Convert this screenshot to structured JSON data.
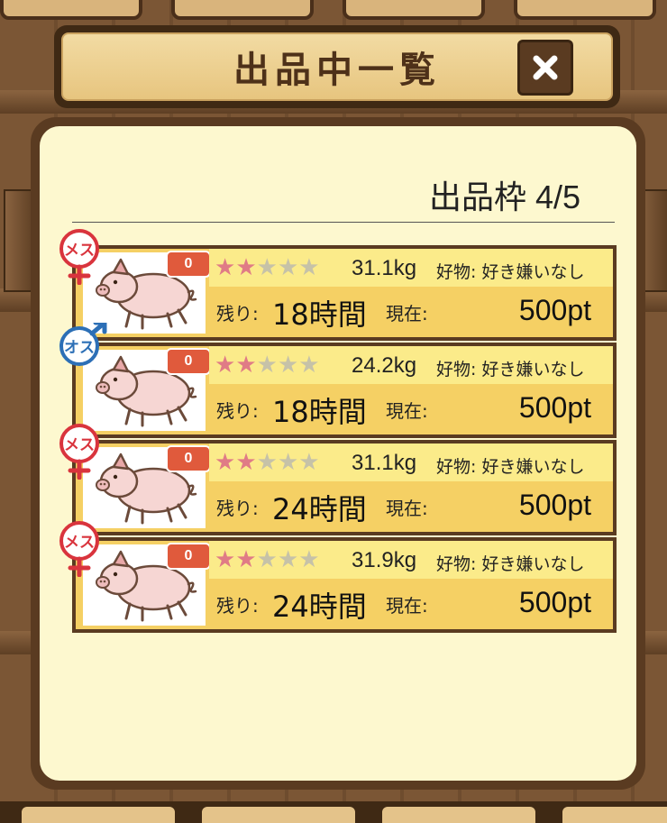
{
  "dialog": {
    "title": "出品中一覧",
    "close_label": "×"
  },
  "slots": {
    "label": "出品枠 4/5"
  },
  "labels": {
    "remaining": "残り:",
    "current": "現在:",
    "favorite_prefix": "好物:"
  },
  "colors": {
    "female": "#d9343d",
    "male": "#2c6fb6",
    "row_top": "#fbeb8a",
    "row_bottom": "#f5d064",
    "frame": "#5a3b21"
  },
  "listings": [
    {
      "sex": "female",
      "sex_label": "メス",
      "count": "0",
      "stars": 2,
      "max_stars": 5,
      "weight": "31.1kg",
      "favorite": "好き嫌いなし",
      "remaining": "18時間",
      "price": "500pt"
    },
    {
      "sex": "male",
      "sex_label": "オス",
      "count": "0",
      "stars": 2,
      "max_stars": 5,
      "weight": "24.2kg",
      "favorite": "好き嫌いなし",
      "remaining": "18時間",
      "price": "500pt"
    },
    {
      "sex": "female",
      "sex_label": "メス",
      "count": "0",
      "stars": 2,
      "max_stars": 5,
      "weight": "31.1kg",
      "favorite": "好き嫌いなし",
      "remaining": "24時間",
      "price": "500pt"
    },
    {
      "sex": "female",
      "sex_label": "メス",
      "count": "0",
      "stars": 2,
      "max_stars": 5,
      "weight": "31.9kg",
      "favorite": "好き嫌いなし",
      "remaining": "24時間",
      "price": "500pt"
    }
  ]
}
